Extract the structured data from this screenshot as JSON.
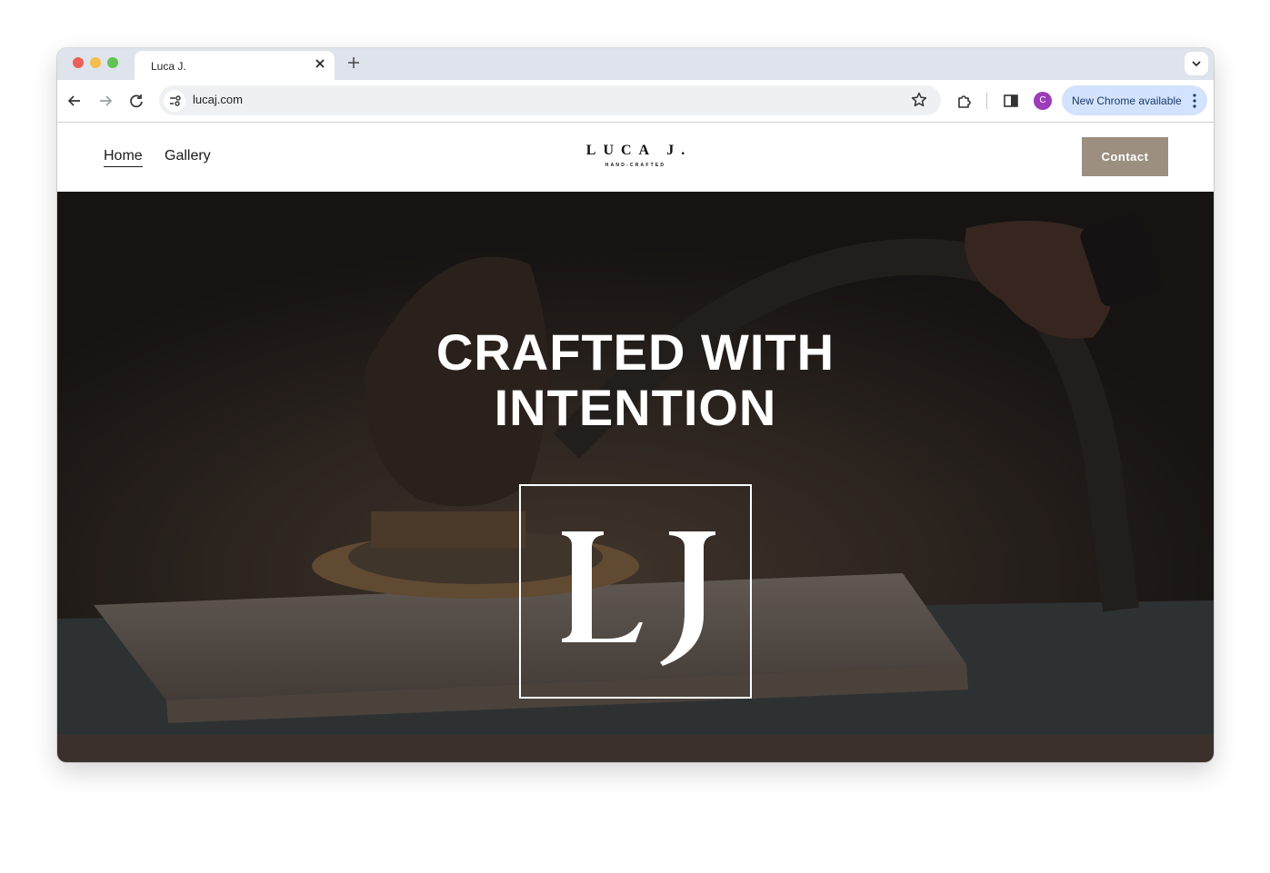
{
  "browser": {
    "tab_title": "Luca J.",
    "url": "lucaj.com",
    "profile_initial": "C",
    "update_label": "New Chrome available",
    "icons": [
      "back-icon",
      "forward-icon",
      "reload-icon",
      "site-info-icon",
      "bookmark-star-icon",
      "extensions-icon",
      "side-panel-icon",
      "more-vert-icon",
      "close-icon",
      "plus-icon",
      "chevron-down-icon"
    ]
  },
  "site": {
    "nav": [
      {
        "label": "Home",
        "active": true
      },
      {
        "label": "Gallery",
        "active": false
      }
    ],
    "logo": {
      "name": "LUCA J.",
      "tagline": "HAND-CRAFTED"
    },
    "contact_label": "Contact",
    "hero": {
      "title_line1": "CRAFTED WITH",
      "title_line2": "INTENTION",
      "monogram": "LJ"
    }
  },
  "colors": {
    "contact_button": "#9c8f80",
    "hero_overlay": "#1c1816",
    "bottom_band": "#3c302d",
    "update_pill": "#d3e3fd",
    "avatar": "#9d3cb8"
  }
}
